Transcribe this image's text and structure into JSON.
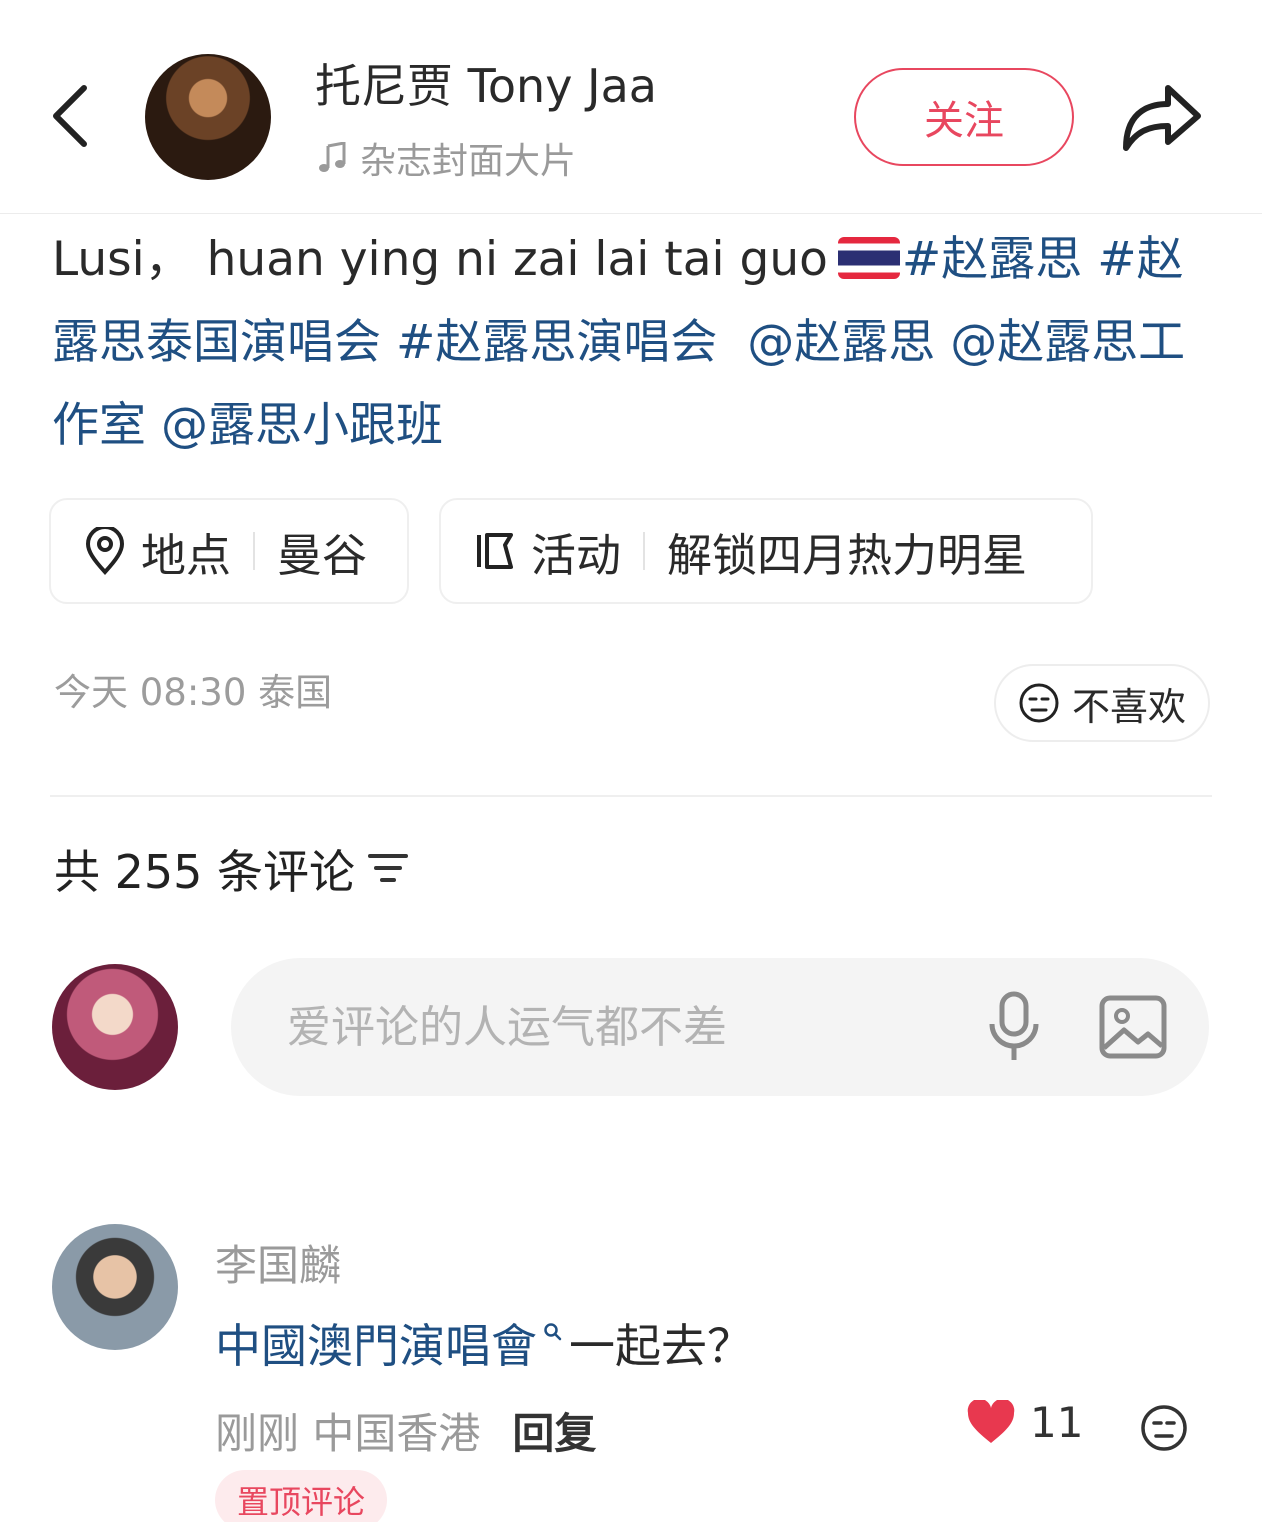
{
  "header": {
    "author_name": "托尼贾 Tony Jaa",
    "music_label": "杂志封面大片",
    "follow_label": "关注"
  },
  "caption": {
    "text": "Lusi， huan ying ni zai lai tai guo",
    "tags": [
      "#赵露思",
      "#赵露思泰国演唱会",
      "#赵露思演唱会"
    ],
    "mentions": [
      "@赵露思",
      "@赵露思工作室",
      "@露思小跟班"
    ]
  },
  "chips": {
    "location_label": "地点",
    "location_value": "曼谷",
    "activity_label": "活动",
    "activity_value": "解锁四月热力明星"
  },
  "meta": {
    "post_time": "今天 08:30 泰国",
    "dislike_label": "不喜欢"
  },
  "comments": {
    "count_label": "共 255 条评论",
    "input_placeholder": "爱评论的人运气都不差",
    "items": [
      {
        "author": "李国麟",
        "text_link": "中國澳門演唱會",
        "text_rest": "一起去？",
        "time": "刚刚",
        "location": "中国香港",
        "reply_label": "回复",
        "likes": "11",
        "badge": "置顶评论"
      }
    ]
  },
  "colors": {
    "accent": "#e8475f",
    "link": "#1f4f82",
    "muted": "#9a9a9a"
  }
}
